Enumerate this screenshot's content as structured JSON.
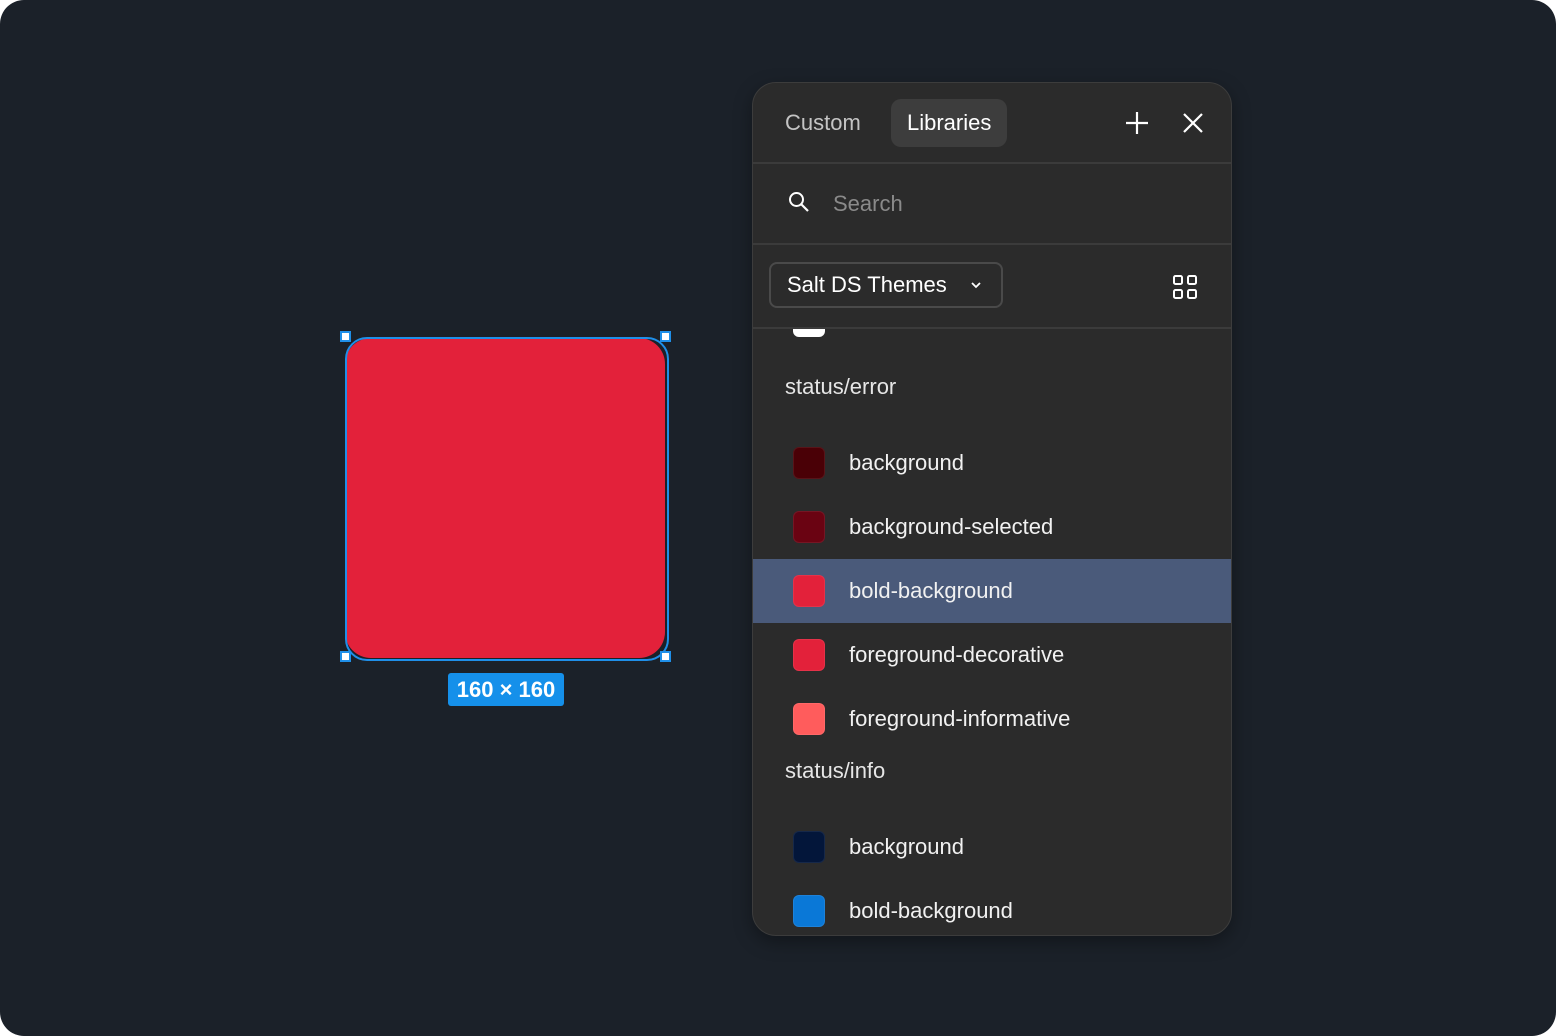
{
  "canvas": {
    "shape_color": "#e3213a",
    "size_label": "160 × 160"
  },
  "panel": {
    "tabs": [
      {
        "label": "Custom",
        "active": false
      },
      {
        "label": "Libraries",
        "active": true
      }
    ],
    "icons": {
      "add": "plus-icon",
      "close": "close-icon",
      "search": "search-icon",
      "grid": "grid-view-icon",
      "dropdown": "chevron-down-icon"
    },
    "search": {
      "placeholder": "Search",
      "value": ""
    },
    "library": {
      "selected": "Salt DS Themes"
    },
    "groups": [
      {
        "title": "status/error",
        "items": [
          {
            "label": "background",
            "color": "#4a0006",
            "selected": false
          },
          {
            "label": "background-selected",
            "color": "#6a0312",
            "selected": false
          },
          {
            "label": "bold-background",
            "color": "#e3213a",
            "selected": true
          },
          {
            "label": "foreground-decorative",
            "color": "#e3213a",
            "selected": false
          },
          {
            "label": "foreground-informative",
            "color": "#ff5c5c",
            "selected": false
          }
        ]
      },
      {
        "title": "status/info",
        "items": [
          {
            "label": "background",
            "color": "#03163a",
            "selected": false
          },
          {
            "label": "bold-background",
            "color": "#0a78d7",
            "selected": false
          }
        ]
      }
    ]
  }
}
